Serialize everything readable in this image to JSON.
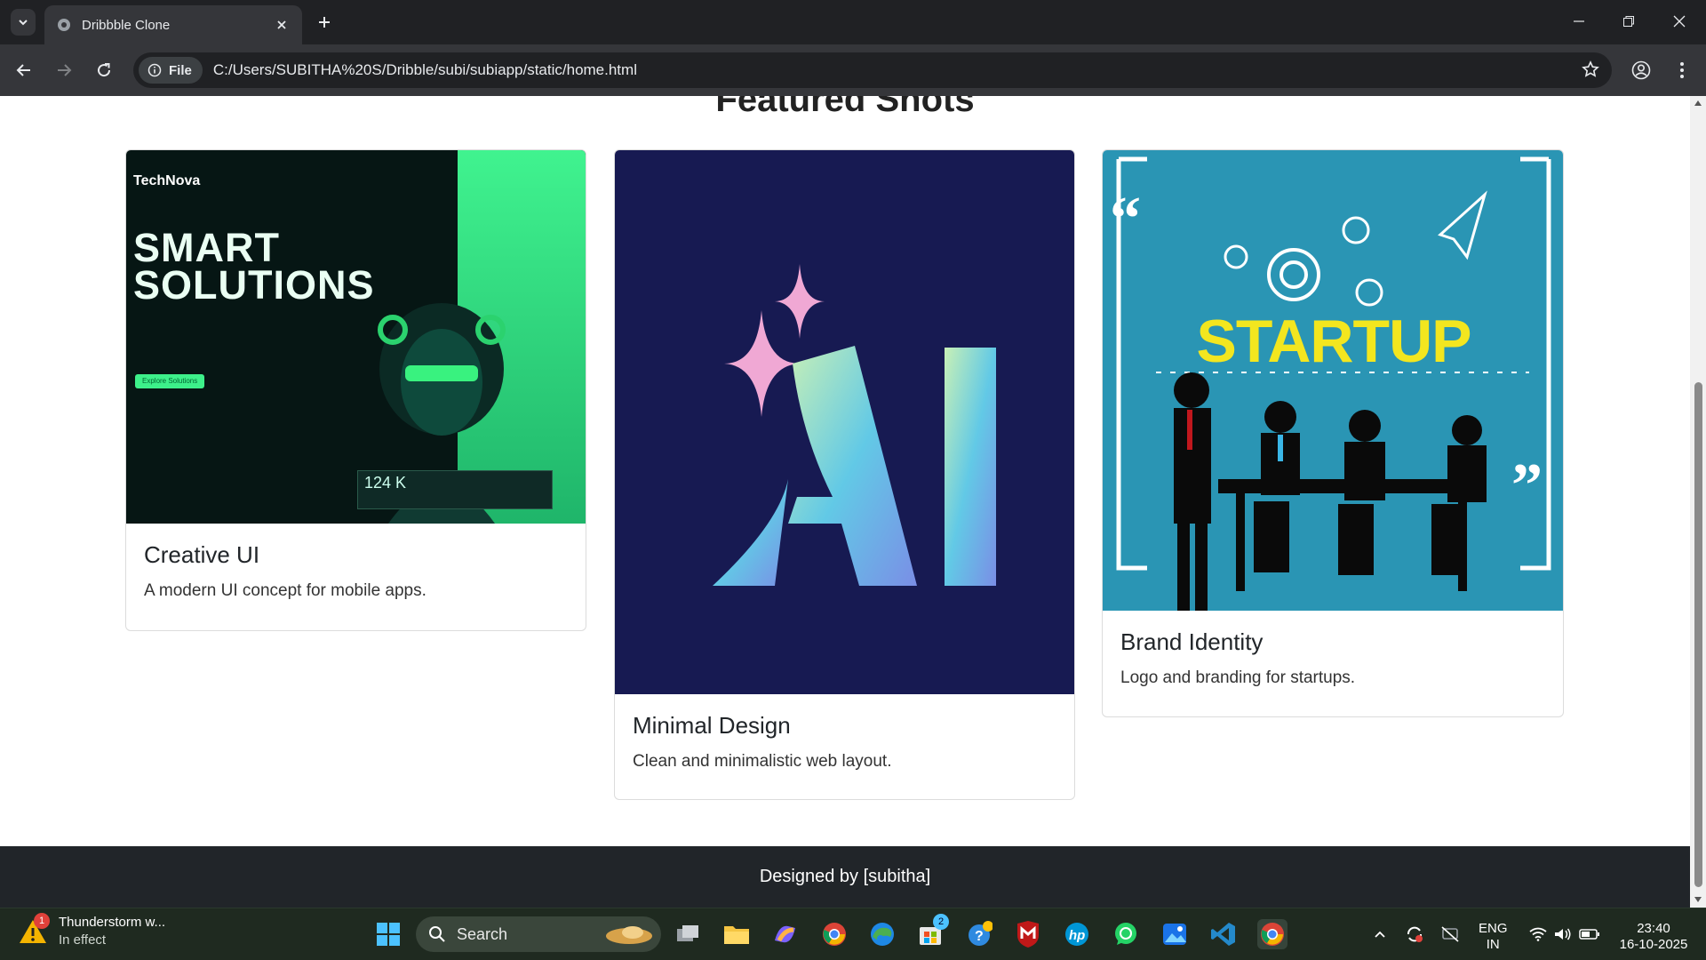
{
  "browser": {
    "tab_title": "Dribbble Clone",
    "url_chip": "File",
    "url": "C:/Users/SUBITHA%20S/Dribble/subi/subiapp/static/home.html"
  },
  "page": {
    "heading": "Featured Shots",
    "cards": [
      {
        "title": "Creative UI",
        "text": "A modern UI concept for mobile apps.",
        "image": {
          "brand": "TechNova",
          "headline_1": "SMART",
          "headline_2": "SOLUTIONS",
          "stat": "124 K",
          "button": "Explore Solutions"
        }
      },
      {
        "title": "Minimal Design",
        "text": "Clean and minimalistic web layout.",
        "image": {
          "logo_text": "AI"
        }
      },
      {
        "title": "Brand Identity",
        "text": "Logo and branding for startups.",
        "image": {
          "word": "STARTUP"
        }
      }
    ],
    "footer": "Designed by [subitha]"
  },
  "taskbar": {
    "weather_title": "Thunderstorm w...",
    "weather_sub": "In effect",
    "weather_badge": "1",
    "search_label": "Search",
    "store_badge": "2",
    "lang_1": "ENG",
    "lang_2": "IN",
    "time": "23:40",
    "date": "16-10-2025"
  },
  "colors": {
    "browser_bg": "#202124",
    "toolbar_bg": "#35363a",
    "footer_bg": "#212529",
    "taskbar_bg": "#1f2a20",
    "ai_bg": "#171a52",
    "startup_bg": "#2a95b4",
    "startup_text": "#f3e61f",
    "technova_accent": "#3df08a"
  }
}
